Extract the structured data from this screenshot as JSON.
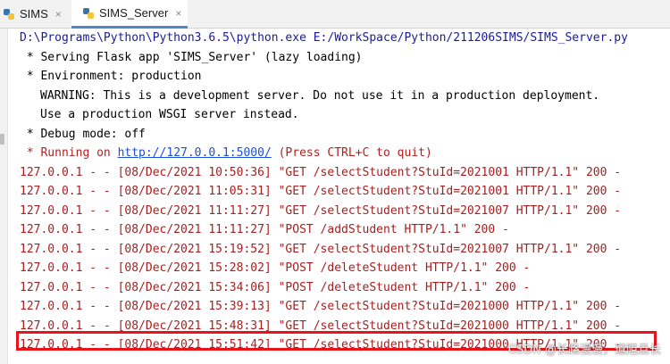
{
  "tabs": [
    {
      "label": "SIMS",
      "close": "×"
    },
    {
      "label": "SIMS_Server",
      "close": "×"
    }
  ],
  "console": {
    "command": "D:\\Programs\\Python\\Python3.6.5\\python.exe E:/WorkSpace/Python/211206SIMS/SIMS_Server.py",
    "serving": " * Serving Flask app 'SIMS_Server' (lazy loading)",
    "environment": " * Environment: production",
    "warning1": "WARNING: This is a development server. Do not use it in a production deployment.",
    "warning2": "Use a production WSGI server instead.",
    "debug": " * Debug mode: off",
    "running_prefix": " * Running on ",
    "running_url": "http://127.0.0.1:5000/",
    "running_suffix": " (Press CTRL+C to quit)",
    "logs": [
      "127.0.0.1 - - [08/Dec/2021 10:50:36] \"GET /selectStudent?StuId=2021001 HTTP/1.1\" 200 -",
      "127.0.0.1 - - [08/Dec/2021 11:05:31] \"GET /selectStudent?StuId=2021001 HTTP/1.1\" 200 -",
      "127.0.0.1 - - [08/Dec/2021 11:11:27] \"GET /selectStudent?StuId=2021007 HTTP/1.1\" 200 -",
      "127.0.0.1 - - [08/Dec/2021 11:11:27] \"POST /addStudent HTTP/1.1\" 200 -",
      "127.0.0.1 - - [08/Dec/2021 15:19:52] \"GET /selectStudent?StuId=2021007 HTTP/1.1\" 200 -",
      "127.0.0.1 - - [08/Dec/2021 15:28:02] \"POST /deleteStudent HTTP/1.1\" 200 -",
      "127.0.0.1 - - [08/Dec/2021 15:34:06] \"POST /deleteStudent HTTP/1.1\" 200 -",
      "127.0.0.1 - - [08/Dec/2021 15:39:13] \"GET /selectStudent?StuId=2021000 HTTP/1.1\" 200 -",
      "127.0.0.1 - - [08/Dec/2021 15:48:31] \"GET /selectStudent?StuId=2021000 HTTP/1.1\" 200 -",
      "127.0.0.1 - - [08/Dec/2021 15:51:42] \"GET /selectStudent?StuId=2021000 HTTP/1.1\" 200 -"
    ]
  },
  "watermark": "CSDN @长路漫漫，道阻且长",
  "colors": {
    "command": "#1a1a9a",
    "log": "#a52020",
    "link": "#1c4fd6",
    "highlight": "#e8141a",
    "tab_active_underline": "#4a88c7"
  }
}
